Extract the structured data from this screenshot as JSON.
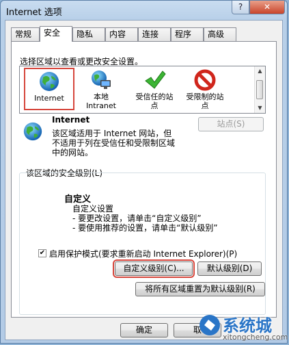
{
  "window": {
    "title": "Internet 选项",
    "help_label": "?",
    "close_label": "✕"
  },
  "tabs": [
    "常规",
    "安全",
    "隐私",
    "内容",
    "连接",
    "程序",
    "高级"
  ],
  "security": {
    "select_zone_label": "选择区域以查看或更改安全设置。",
    "zones": [
      {
        "name": "Internet",
        "icon": "globe-icon",
        "selected": true
      },
      {
        "name": "本地 Intranet",
        "line1": "本地",
        "line2": "Intranet",
        "icon": "intranet-icon"
      },
      {
        "name": "受信任的站点",
        "line1": "受信任的站",
        "line2": "点",
        "icon": "checkmark-icon"
      },
      {
        "name": "受限制的站点",
        "line1": "受限制的站",
        "line2": "点",
        "icon": "prohibited-icon"
      }
    ],
    "zone_title": "Internet",
    "zone_desc": [
      "该区域适用于 Internet 网站，但",
      "不适用于列在受信任和受限制区域",
      "中的网站。"
    ],
    "sites_button": "站点(S)",
    "level_group_label": "该区域的安全级别(L)",
    "level_name": "自定义",
    "level_desc": [
      "自定义设置",
      "- 要更改设置，请单击“自定义级别”",
      "- 要使用推荐的设置，请单击“默认级别”"
    ],
    "protected_mode_label": "启用保护模式(要求重新启动 Internet Explorer)(P)",
    "protected_mode_checked": true,
    "custom_level_button": "自定义级别(C)...",
    "default_level_button": "默认级别(D)",
    "reset_all_button": "将所有区域重置为默认级别(R)"
  },
  "footer": {
    "ok_button": "确定",
    "cancel_button": "取"
  },
  "watermark": {
    "text": "系统城",
    "url": "xitongcheng.com"
  },
  "colors": {
    "highlight": "#d6453b",
    "title_bar": "#b7cfe8"
  }
}
